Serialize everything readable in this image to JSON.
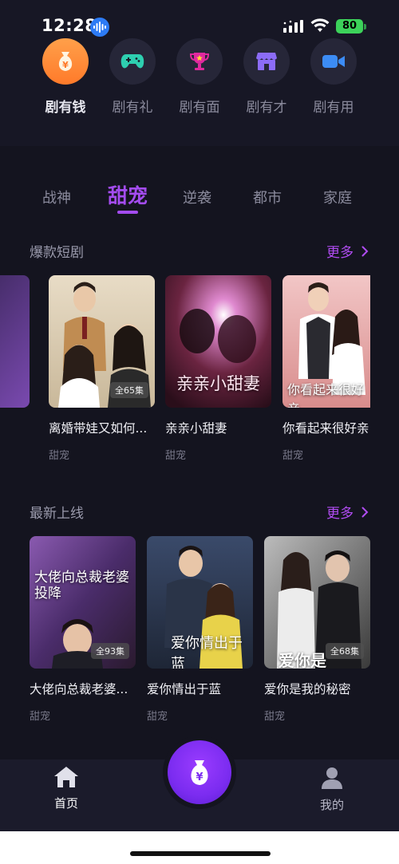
{
  "status": {
    "time": "12:28",
    "battery": "80"
  },
  "top_icons": [
    {
      "label": "剧有钱",
      "icon": "money-bag-icon",
      "active": true
    },
    {
      "label": "剧有礼",
      "icon": "gamepad-icon",
      "active": false
    },
    {
      "label": "剧有面",
      "icon": "trophy-icon",
      "active": false
    },
    {
      "label": "剧有才",
      "icon": "store-icon",
      "active": false
    },
    {
      "label": "剧有用",
      "icon": "video-camera-icon",
      "active": false
    }
  ],
  "tabs": [
    {
      "label": "战神",
      "active": false
    },
    {
      "label": "甜宠",
      "active": true
    },
    {
      "label": "逆袭",
      "active": false
    },
    {
      "label": "都市",
      "active": false
    },
    {
      "label": "家庭",
      "active": false
    }
  ],
  "sections": [
    {
      "title": "爆款短剧",
      "more": "更多",
      "cards": [
        {
          "title": "离婚带娃又如何...",
          "tag": "甜宠",
          "episodes": "全65集",
          "poster_text": ""
        },
        {
          "title": "亲亲小甜妻",
          "tag": "甜宠",
          "episodes": "",
          "poster_text": "亲亲小甜妻"
        },
        {
          "title": "你看起来很好亲",
          "tag": "甜宠",
          "episodes": "",
          "poster_text": "你看起来很好亲"
        }
      ]
    },
    {
      "title": "最新上线",
      "more": "更多",
      "cards": [
        {
          "title": "大佬向总裁老婆...",
          "tag": "甜宠",
          "episodes": "全93集",
          "poster_text": "大佬向总裁老婆投降"
        },
        {
          "title": "爱你情出于蓝",
          "tag": "甜宠",
          "episodes": "",
          "poster_text": "爱你情出于蓝"
        },
        {
          "title": "爱你是我的秘密",
          "tag": "甜宠",
          "episodes": "全68集",
          "poster_text": "爱你是"
        }
      ]
    }
  ],
  "bottom_nav": {
    "home": "首页",
    "center_icon": "yuan-money-bag-icon",
    "mine": "我的"
  },
  "colors": {
    "accent": "#a44cf0",
    "orange": "#ff8a3a",
    "background": "#14141f"
  }
}
